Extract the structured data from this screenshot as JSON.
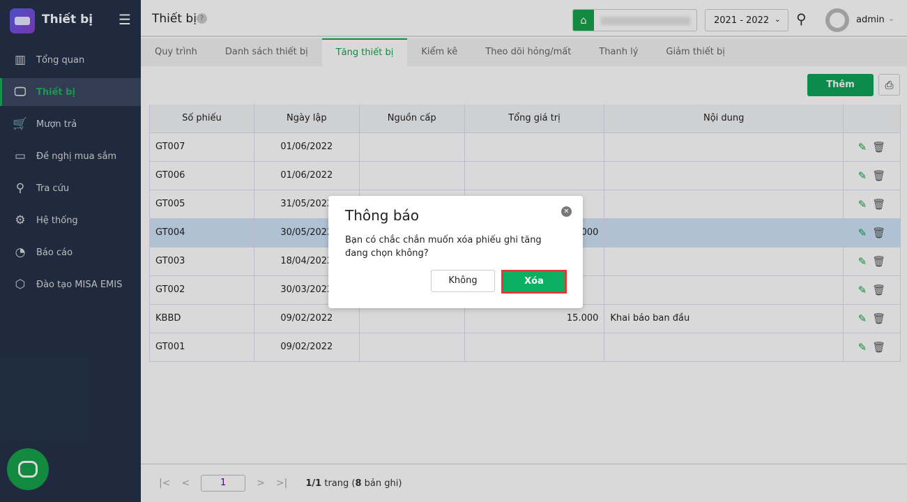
{
  "app": {
    "title": "Thiết bị"
  },
  "sidebar": {
    "items": [
      {
        "label": "Tổng quan",
        "icon": "chart-bars-icon"
      },
      {
        "label": "Thiết bị",
        "icon": "monitor-icon",
        "active": true
      },
      {
        "label": "Mượn trả",
        "icon": "cart-icon"
      },
      {
        "label": "Đề nghị mua sắm",
        "icon": "projector-icon"
      },
      {
        "label": "Tra cứu",
        "icon": "search-icon"
      },
      {
        "label": "Hệ thống",
        "icon": "gear-icon"
      },
      {
        "label": "Báo cáo",
        "icon": "pie-chart-icon"
      },
      {
        "label": "Đào tạo MISA EMIS",
        "icon": "cube-icon"
      }
    ]
  },
  "header": {
    "title": "Thiết bị",
    "help": "?",
    "year": "2021 - 2022",
    "user": "admin"
  },
  "tabs": [
    "Quy trình",
    "Danh sách thiết bị",
    "Tăng thiết bị",
    "Kiểm kê",
    "Theo dõi hỏng/mất",
    "Thanh lý",
    "Giảm thiết bị"
  ],
  "toolbar": {
    "add": "Thêm"
  },
  "table": {
    "headers": [
      "Số phiếu",
      "Ngày lập",
      "Nguồn cấp",
      "Tổng giá trị",
      "Nội dung",
      ""
    ],
    "rows": [
      [
        "GT007",
        "01/06/2022",
        "",
        "",
        ""
      ],
      [
        "GT006",
        "01/06/2022",
        "",
        "",
        ""
      ],
      [
        "GT005",
        "31/05/2022",
        "",
        "",
        ""
      ],
      [
        "GT004",
        "30/05/2022",
        "",
        "000",
        ""
      ],
      [
        "GT003",
        "18/04/2022",
        "",
        "",
        ""
      ],
      [
        "GT002",
        "30/03/2022",
        "",
        "",
        ""
      ],
      [
        "KBBD",
        "09/02/2022",
        "",
        "15.000",
        "Khai báo ban đầu"
      ],
      [
        "GT001",
        "09/02/2022",
        "",
        "",
        ""
      ]
    ]
  },
  "pager": {
    "page": "1",
    "info_pages": "1/1",
    "info_trang": " trang (",
    "info_count": "8",
    "info_tail": " bản ghi)"
  },
  "dialog": {
    "title": "Thông báo",
    "message": "Bạn có chắc chắn muốn xóa phiếu ghi tăng đang chọn không?",
    "cancel": "Không",
    "confirm": "Xóa"
  }
}
